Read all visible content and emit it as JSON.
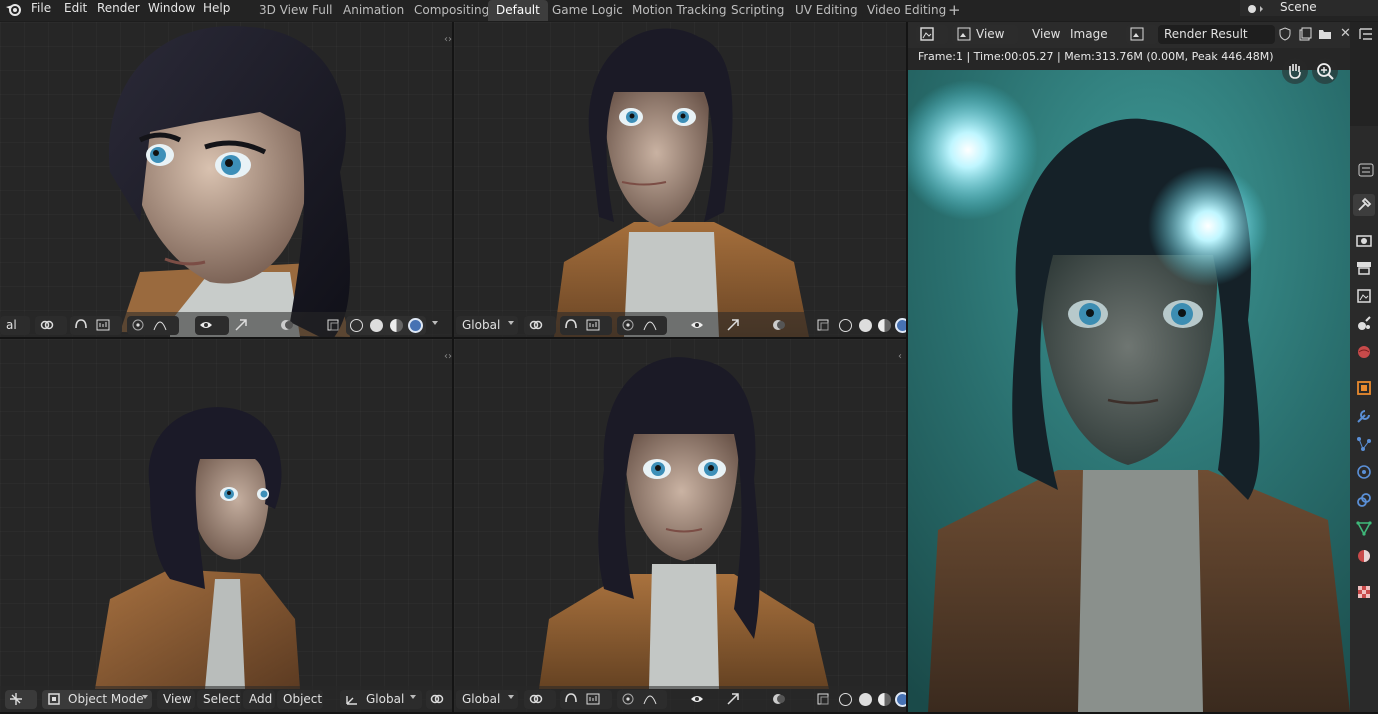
{
  "menu": [
    "File",
    "Edit",
    "Render",
    "Window",
    "Help"
  ],
  "workspaces": [
    "3D View Full",
    "Animation",
    "Compositing",
    "Default",
    "Game Logic",
    "Motion Tracking",
    "Scripting",
    "UV Editing",
    "Video Editing"
  ],
  "active_workspace": "Default",
  "add_workspace": "+",
  "scene": "Scene",
  "viewport_header": {
    "transform_orientation": "Global",
    "transform_orientation_partial": "al",
    "mode": "Object Mode",
    "menus": [
      "View",
      "Select",
      "Add",
      "Object"
    ]
  },
  "image_editor": {
    "view_menu": "View",
    "menus": [
      "View",
      "Image"
    ],
    "image_name": "Render Result",
    "frame_info": "Frame:1 | Time:00:05.27 | Mem:313.76M (0.00M, Peak 446.48M)"
  },
  "colors": {
    "accent": "#4772b3",
    "topbar": "#232323",
    "viewport_bg": "#262626",
    "render_teal": "#2c7e80"
  },
  "properties_tabs": [
    "tool-icon",
    "render-icon",
    "output-icon",
    "view-layer-icon",
    "scene-icon",
    "world-icon",
    "object-icon",
    "modifier-icon",
    "particles-icon",
    "physics-icon",
    "constraints-icon",
    "data-icon",
    "material-icon",
    "texture-icon"
  ]
}
